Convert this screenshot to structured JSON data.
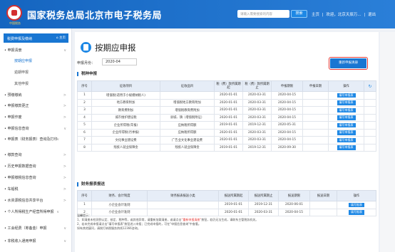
{
  "header": {
    "title": "国家税务总局北京市电子税务局",
    "logo_caption": "中国税务",
    "search_placeholder": "请输入需要搜索的内容",
    "search_button": "搜索",
    "nav_home": "主页",
    "nav_sep": "|",
    "nav_greeting": "欢迎，北京天辰万...",
    "nav_exit": "退出"
  },
  "sidebar": {
    "head_label": "税费申报及缴纳",
    "head_home": "主页",
    "items": [
      {
        "label": "申报清册",
        "arrow": "∨"
      },
      {
        "label": "按期应申报",
        "arrow": ""
      },
      {
        "label": "逾期申报",
        "arrow": ""
      },
      {
        "label": "其他申报",
        "arrow": ""
      },
      {
        "label": "预缴缴纳",
        "arrow": ">"
      },
      {
        "label": "申报缴款更正",
        "arrow": ">"
      },
      {
        "label": "申报作废",
        "arrow": ">"
      },
      {
        "label": "申报信息查询",
        "arrow": "∨"
      },
      {
        "label": "申报表（财务报表）查询及打印",
        "arrow": "∨"
      },
      {
        "label": "缴款查询",
        "arrow": ">"
      },
      {
        "label": "历史申报数据查询",
        "arrow": ">"
      },
      {
        "label": "申报缴税信息查询",
        "arrow": ">"
      },
      {
        "label": "车船税",
        "arrow": ">"
      },
      {
        "label": "水资源税信息共享平台",
        "arrow": ">"
      },
      {
        "label": "个人所得税生产经营所得申报",
        "arrow": "∨"
      },
      {
        "label": "工会经费（筹备金）申报",
        "arrow": "∨"
      },
      {
        "label": "非税收入通用申报",
        "arrow": "∨"
      }
    ]
  },
  "main": {
    "title": "按期应申报",
    "period_label": "申报月份：",
    "period_value": "2020-04",
    "report_button": "重新申报清册",
    "tax_section_title": "税种申报",
    "tax_columns": [
      "序号",
      "征收项目",
      "征收品目",
      "税（费）款所属期起",
      "税（费）款所属期止",
      "申报期限",
      "申报日期",
      "操作",
      "↻"
    ],
    "tax_rows": [
      [
        "1",
        "增值税(适用于小规模纳税人)",
        "",
        "2020-01-01",
        "2020-03-31",
        "2020-04-15",
        "",
        "填写申报表"
      ],
      [
        "2",
        "地方教育附加",
        "增值税地方教育附加",
        "2020-01-01",
        "2020-03-31",
        "2020-04-15",
        "",
        "填写申报表"
      ],
      [
        "3",
        "教育费附加",
        "增值税教育费附加",
        "2020-01-01",
        "2020-03-31",
        "2020-04-15",
        "",
        "填写申报表"
      ],
      [
        "4",
        "城市维护建设税",
        "县城、镇（增值税附征）",
        "2020-01-01",
        "2020-03-31",
        "2020-04-15",
        "",
        "填写申报表"
      ],
      [
        "5",
        "企业所得税(年报)",
        "应纳税所得额",
        "2019-01-01",
        "2019-12-31",
        "2020-05-31",
        "",
        "填写申报表"
      ],
      [
        "6",
        "企业所得税(月季报)",
        "应纳税所得额",
        "2020-01-01",
        "2020-03-31",
        "2020-04-15",
        "",
        "填写申报表"
      ],
      [
        "7",
        "文化事业建设费",
        "广告业文化事业建设费",
        "2020-01-01",
        "2020-03-31",
        "2020-04-15",
        "",
        "填写申报表"
      ],
      [
        "8",
        "残疾人就业保障金",
        "残疾人就业保障金",
        "2019-01-01",
        "2019-12-31",
        "2020-09-30",
        "",
        "填写申报表"
      ]
    ],
    "fin_section_title": "财务报表报送",
    "fin_columns": [
      "序号",
      "财务、会计制度",
      "财务报表报送小类",
      "报送所属期起",
      "报送所属期止",
      "报送期限",
      "报送日期",
      "操作"
    ],
    "fin_rows": [
      [
        "1",
        "小企业会计准则",
        "",
        "2019-01-01",
        "2019-12-31",
        "2020-06-01",
        "",
        "填写报表"
      ],
      [
        "2",
        "小企业会计准则",
        "",
        "2020-01-01",
        "2020-03-31",
        "2020-04-15",
        "",
        "填写报表"
      ]
    ],
    "notes": {
      "heading": "温馨提示：",
      "line1": "1、如清册未检测到认定、核定、税种等，或其他异常，请重新加载清册，或请点击",
      "line1_highlight": "\"重新申报清册\"",
      "line1_tail": "按钮，若仍无法生成，请联系主管税务机关。",
      "line2": "2、若未完成申报请点击\"填写申报表\"按钮进入申报；已完成申报的，可在\"申报信息查询\"中查看。",
      "line3": "如有其他疑问，请拨打纳税服务热线12366咨询。"
    }
  },
  "colors": {
    "header_bg": "#1565c0",
    "accent": "#1976d2",
    "highlight_border": "#e53935"
  }
}
